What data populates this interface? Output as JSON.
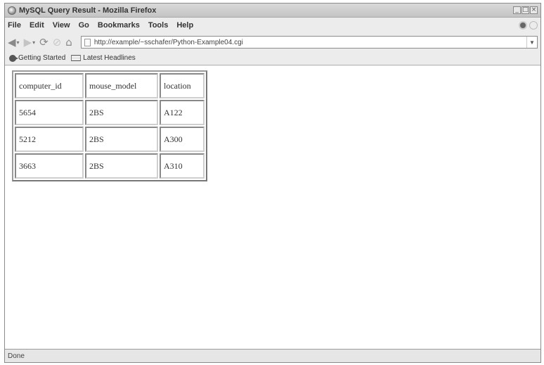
{
  "window": {
    "title": "MySQL Query Result - Mozilla Firefox",
    "buttons": {
      "minimize": "_",
      "maximize": "□",
      "close": "×"
    }
  },
  "menubar": {
    "items": [
      {
        "label": "File"
      },
      {
        "label": "Edit"
      },
      {
        "label": "View"
      },
      {
        "label": "Go"
      },
      {
        "label": "Bookmarks"
      },
      {
        "label": "Tools"
      },
      {
        "label": "Help"
      }
    ]
  },
  "navbar": {
    "back_icon": "back-arrow-icon",
    "forward_icon": "forward-arrow-icon",
    "reload_icon": "reload-icon",
    "stop_icon": "stop-icon",
    "home_icon": "home-icon",
    "url": "http://example/~sschafer/Python-Example04.cgi"
  },
  "bookmarks": {
    "items": [
      {
        "label": "Getting Started"
      },
      {
        "label": "Latest Headlines"
      }
    ]
  },
  "table": {
    "headers": [
      "computer_id",
      "mouse_model",
      "location"
    ],
    "rows": [
      [
        "5654",
        "2BS",
        "A122"
      ],
      [
        "5212",
        "2BS",
        "A300"
      ],
      [
        "3663",
        "2BS",
        "A310"
      ]
    ]
  },
  "status": {
    "text": "Done"
  }
}
